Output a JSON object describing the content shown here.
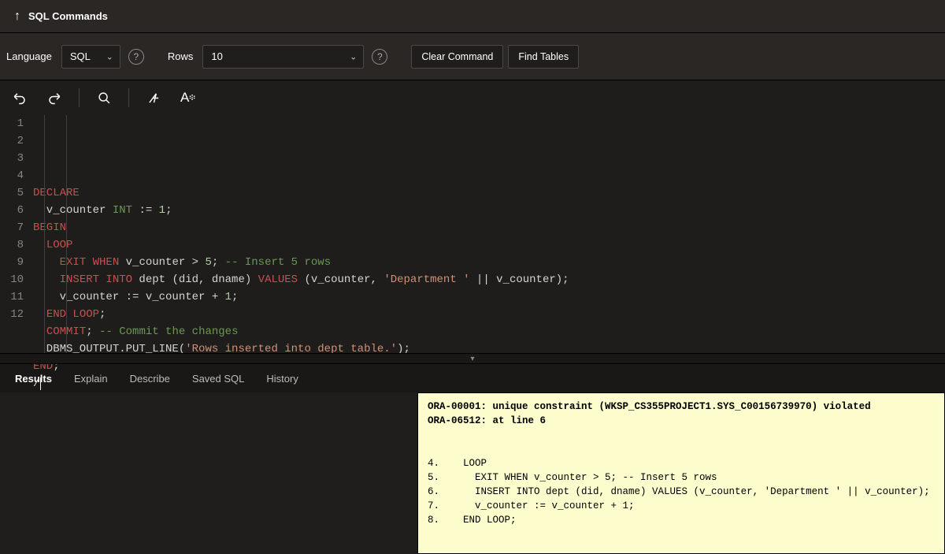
{
  "header": {
    "title": "SQL Commands"
  },
  "toolbar": {
    "language_label": "Language",
    "language_value": "SQL",
    "rows_label": "Rows",
    "rows_value": "10",
    "clear_btn": "Clear Command",
    "find_btn": "Find Tables"
  },
  "editor": {
    "lines": [
      {
        "n": 1,
        "tokens": [
          {
            "c": "kw-red",
            "t": "DECLARE"
          }
        ]
      },
      {
        "n": 2,
        "tokens": [
          {
            "c": "kw-plain",
            "t": "  v_counter "
          },
          {
            "c": "kw-type",
            "t": "INT"
          },
          {
            "c": "kw-plain",
            "t": " := "
          },
          {
            "c": "kw-num",
            "t": "1"
          },
          {
            "c": "kw-plain",
            "t": ";"
          }
        ]
      },
      {
        "n": 3,
        "tokens": [
          {
            "c": "kw-red",
            "t": "BEGIN"
          }
        ]
      },
      {
        "n": 4,
        "tokens": [
          {
            "c": "kw-plain",
            "t": "  "
          },
          {
            "c": "kw-red",
            "t": "LOOP"
          }
        ]
      },
      {
        "n": 5,
        "tokens": [
          {
            "c": "kw-plain",
            "t": "    "
          },
          {
            "c": "kw-red",
            "t": "EXIT WHEN"
          },
          {
            "c": "kw-plain",
            "t": " v_counter > "
          },
          {
            "c": "kw-num",
            "t": "5"
          },
          {
            "c": "kw-plain",
            "t": "; "
          },
          {
            "c": "kw-comment",
            "t": "-- Insert 5 rows"
          }
        ]
      },
      {
        "n": 6,
        "tokens": [
          {
            "c": "kw-plain",
            "t": "    "
          },
          {
            "c": "kw-red",
            "t": "INSERT INTO"
          },
          {
            "c": "kw-plain",
            "t": " dept (did, dname) "
          },
          {
            "c": "kw-red",
            "t": "VALUES"
          },
          {
            "c": "kw-plain",
            "t": " (v_counter, "
          },
          {
            "c": "kw-str",
            "t": "'Department '"
          },
          {
            "c": "kw-plain",
            "t": " || v_counter);"
          }
        ]
      },
      {
        "n": 7,
        "tokens": [
          {
            "c": "kw-plain",
            "t": "    v_counter := v_counter + "
          },
          {
            "c": "kw-num",
            "t": "1"
          },
          {
            "c": "kw-plain",
            "t": ";"
          }
        ]
      },
      {
        "n": 8,
        "tokens": [
          {
            "c": "kw-plain",
            "t": "  "
          },
          {
            "c": "kw-red",
            "t": "END LOOP"
          },
          {
            "c": "kw-plain",
            "t": ";"
          }
        ]
      },
      {
        "n": 9,
        "tokens": [
          {
            "c": "kw-plain",
            "t": "  "
          },
          {
            "c": "kw-red",
            "t": "COMMIT"
          },
          {
            "c": "kw-plain",
            "t": "; "
          },
          {
            "c": "kw-comment",
            "t": "-- Commit the changes"
          }
        ]
      },
      {
        "n": 10,
        "tokens": [
          {
            "c": "kw-plain",
            "t": "  DBMS_OUTPUT.PUT_LINE("
          },
          {
            "c": "kw-str",
            "t": "'Rows inserted into dept table.'"
          },
          {
            "c": "kw-plain",
            "t": ");"
          }
        ]
      },
      {
        "n": 11,
        "tokens": [
          {
            "c": "kw-red",
            "t": "END"
          },
          {
            "c": "kw-plain",
            "t": ";"
          }
        ]
      },
      {
        "n": 12,
        "tokens": [
          {
            "c": "kw-plain",
            "t": "/"
          }
        ],
        "cursor": true
      }
    ]
  },
  "tabs": {
    "items": [
      {
        "label": "Results",
        "active": true
      },
      {
        "label": "Explain",
        "active": false
      },
      {
        "label": "Describe",
        "active": false
      },
      {
        "label": "Saved SQL",
        "active": false
      },
      {
        "label": "History",
        "active": false
      }
    ]
  },
  "results": {
    "error": [
      "ORA-00001: unique constraint (WKSP_CS355PROJECT1.SYS_C00156739970) violated",
      "ORA-06512: at line 6"
    ],
    "context": [
      "4.    LOOP",
      "5.      EXIT WHEN v_counter > 5; -- Insert 5 rows",
      "6.      INSERT INTO dept (did, dname) VALUES (v_counter, 'Department ' || v_counter);",
      "7.      v_counter := v_counter + 1;",
      "8.    END LOOP;"
    ]
  },
  "editor_toolbar_letter": "A"
}
